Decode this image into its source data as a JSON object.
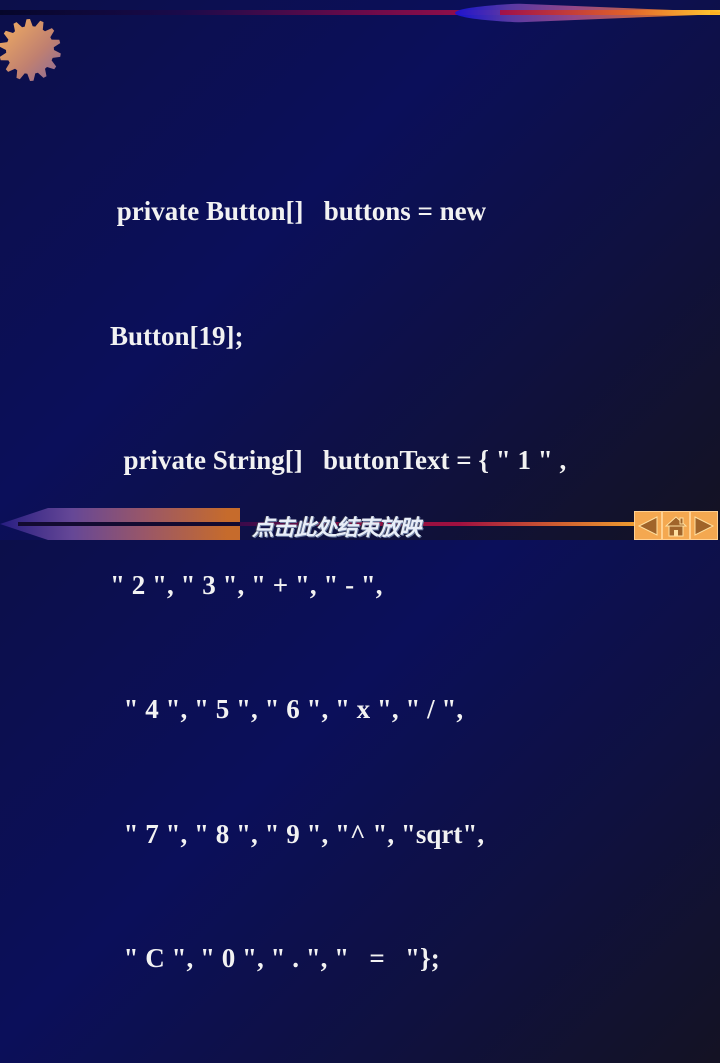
{
  "slide": {
    "code_lines": [
      " private Button[]   buttons = new",
      "Button[19];",
      "  private String[]   buttonText = { \" 1 \" ,",
      "\" 2 \", \" 3 \", \" + \", \" - \",",
      "  \" 4 \", \" 5 \", \" 6 \", \" x \", \" / \",",
      "  \" 7 \", \" 8 \", \" 9 \", \"^ \", \"sqrt\",",
      "  \" C \", \" 0 \", \" . \", \"   =   \"};"
    ],
    "end_show_link": "点击此处结束放映"
  },
  "navigation": {
    "buttons": [
      {
        "name": "previous",
        "icon": "triangle-left-icon"
      },
      {
        "name": "home",
        "icon": "home-icon"
      },
      {
        "name": "next",
        "icon": "triangle-right-icon"
      }
    ]
  },
  "colors": {
    "background": "#0b0f5a",
    "text": "#f2f2f2",
    "nav_button": "#f4a850",
    "nav_icon": "#a0642a",
    "gear": "#e8a060"
  }
}
